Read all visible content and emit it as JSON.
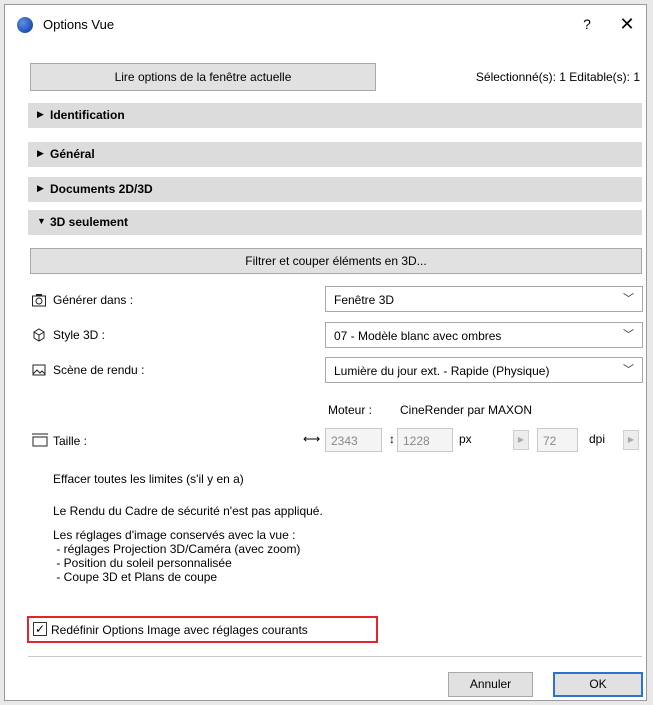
{
  "window": {
    "title": "Options Vue",
    "help": "?",
    "close": "✕"
  },
  "toolbar": {
    "read_label": "Lire options de la fenêtre actuelle",
    "selection_info": "Sélectionné(s): 1 Editable(s): 1"
  },
  "sections": [
    {
      "label": "Identification",
      "expanded": false
    },
    {
      "label": "Général",
      "expanded": false
    },
    {
      "label": "Documents 2D/3D",
      "expanded": false
    },
    {
      "label": "3D seulement",
      "expanded": true
    }
  ],
  "filter_label": "Filtrer et couper éléments en 3D...",
  "rows": {
    "generate": {
      "label": "Générer dans :",
      "value": "Fenêtre 3D",
      "icon": "camera-icon"
    },
    "style3d": {
      "label": "Style 3D :",
      "value": "07 - Modèle blanc avec ombres",
      "icon": "cube-icon"
    },
    "scene": {
      "label": "Scène de rendu :",
      "value": "Lumière du jour ext. - Rapide (Physique)",
      "icon": "image-icon"
    }
  },
  "engine": {
    "label": "Moteur :",
    "value": "CineRender par MAXON"
  },
  "size": {
    "label": "Taille :",
    "width": "2343",
    "height": "1228",
    "unit": "px",
    "resolution": "72",
    "res_unit": "dpi"
  },
  "info": {
    "clear_limits": "Effacer toutes les limites (s'il y en a)",
    "safe_frame": "Le Rendu du Cadre de sécurité n'est pas appliqué.",
    "saved_title": "Les réglages d'image conservés avec la vue :",
    "saved_items": [
      " - réglages Projection 3D/Caméra (avec zoom)",
      " - Position du soleil personnalisée",
      " - Coupe 3D et Plans de coupe"
    ]
  },
  "redefine": {
    "label": "Redéfinir Options Image avec réglages courants",
    "checked": true
  },
  "footer": {
    "cancel": "Annuler",
    "ok": "OK"
  },
  "colors": {
    "highlight_border": "#e3262b",
    "ok_border": "#2b73d1"
  }
}
